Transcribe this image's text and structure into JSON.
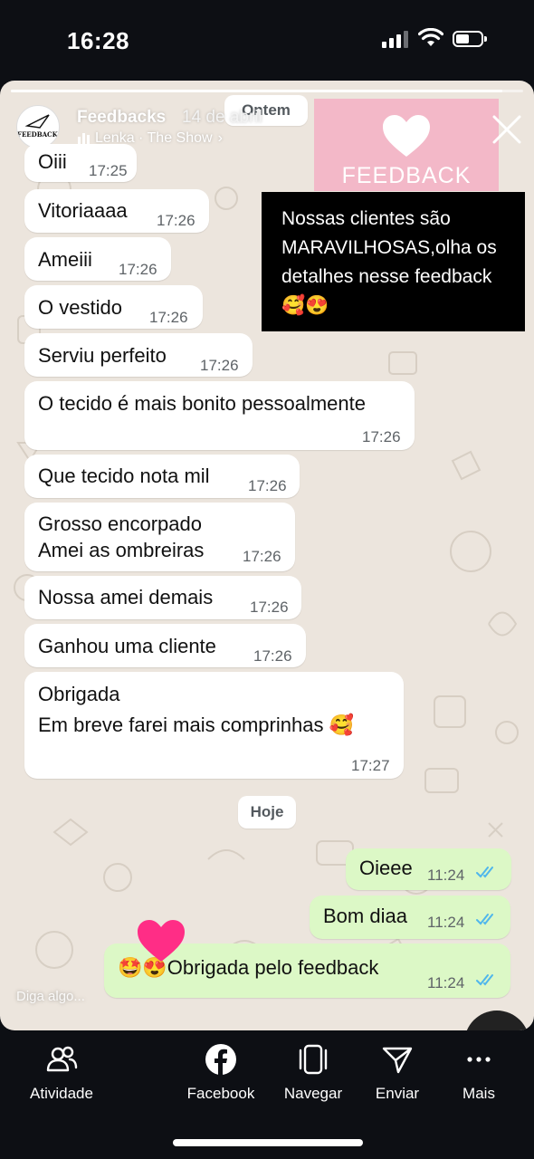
{
  "status_bar": {
    "time": "16:28"
  },
  "story": {
    "account_name": "Feedbacks",
    "posted_date": "14 de abril",
    "music": "Lenka · The Show",
    "avatar_text": "FEEDBACKS",
    "progress": 0.96,
    "image_text": "FEEDBACK",
    "caption": "Nossas clientes são MARAVILHOSAS,olha os detalhes nesse feedback 🥰😍",
    "reply_placeholder": "Diga algo..."
  },
  "chat": {
    "date_label_yesterday": "Ontem",
    "date_label_today": "Hoje",
    "messages": [
      {
        "text": "Oiii",
        "time": "17:25"
      },
      {
        "text": "Vitoriaaaa",
        "time": "17:26"
      },
      {
        "text": "Ameiii",
        "time": "17:26"
      },
      {
        "text": "O vestido",
        "time": "17:26"
      },
      {
        "text": "Serviu perfeito",
        "time": "17:26"
      },
      {
        "text": "O tecido é mais bonito pessoalmente",
        "time": "17:26"
      },
      {
        "text": "Que tecido nota mil",
        "time": "17:26"
      },
      {
        "line1": "Grosso encorpado",
        "line2": "Amei as ombreiras",
        "time": "17:26"
      },
      {
        "text": "Nossa amei demais",
        "time": "17:26"
      },
      {
        "text": "Ganhou uma cliente",
        "time": "17:26"
      },
      {
        "line1": "Obrigada",
        "line2": "Em breve farei mais comprinhas 🥰",
        "time": "17:27"
      }
    ],
    "outgoing": [
      {
        "text": "Oieee",
        "time": "11:24"
      },
      {
        "text": "Bom diaa",
        "time": "11:24"
      },
      {
        "text": "🤩😍Obrigada pelo feedback",
        "time": "11:24"
      }
    ]
  },
  "nav": {
    "items": [
      {
        "label": "Atividade",
        "icon": "people-icon"
      },
      {
        "label": "Facebook",
        "icon": "facebook-icon"
      },
      {
        "label": "Navegar",
        "icon": "browse-icon"
      },
      {
        "label": "Enviar",
        "icon": "send-icon"
      },
      {
        "label": "Mais",
        "icon": "more-icon"
      }
    ]
  },
  "colors": {
    "incoming": "#ffffff",
    "outgoing": "#dcf8c6",
    "ticks": "#4fb6ec",
    "chat_bg": "#ece5dd",
    "story_pink": "#f3b8c8"
  }
}
